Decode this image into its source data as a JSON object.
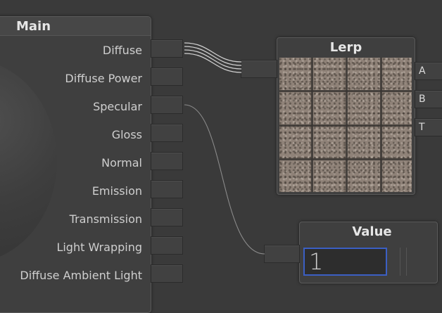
{
  "main_node": {
    "title": "Main",
    "inputs": [
      {
        "label": "Diffuse"
      },
      {
        "label": "Diffuse Power"
      },
      {
        "label": "Specular"
      },
      {
        "label": "Gloss"
      },
      {
        "label": "Normal"
      },
      {
        "label": "Emission"
      },
      {
        "label": "Transmission"
      },
      {
        "label": "Light Wrapping"
      },
      {
        "label": "Diffuse Ambient Light"
      }
    ]
  },
  "lerp_node": {
    "title": "Lerp",
    "outputs": [
      "A",
      "B",
      "T"
    ]
  },
  "value_node": {
    "title": "Value",
    "value": "1"
  },
  "colors": {
    "background": "#3a3a3a",
    "node": "#3f3f3f",
    "selected_field_border": "#3b5fc4",
    "wire": "#cfcfcf"
  }
}
